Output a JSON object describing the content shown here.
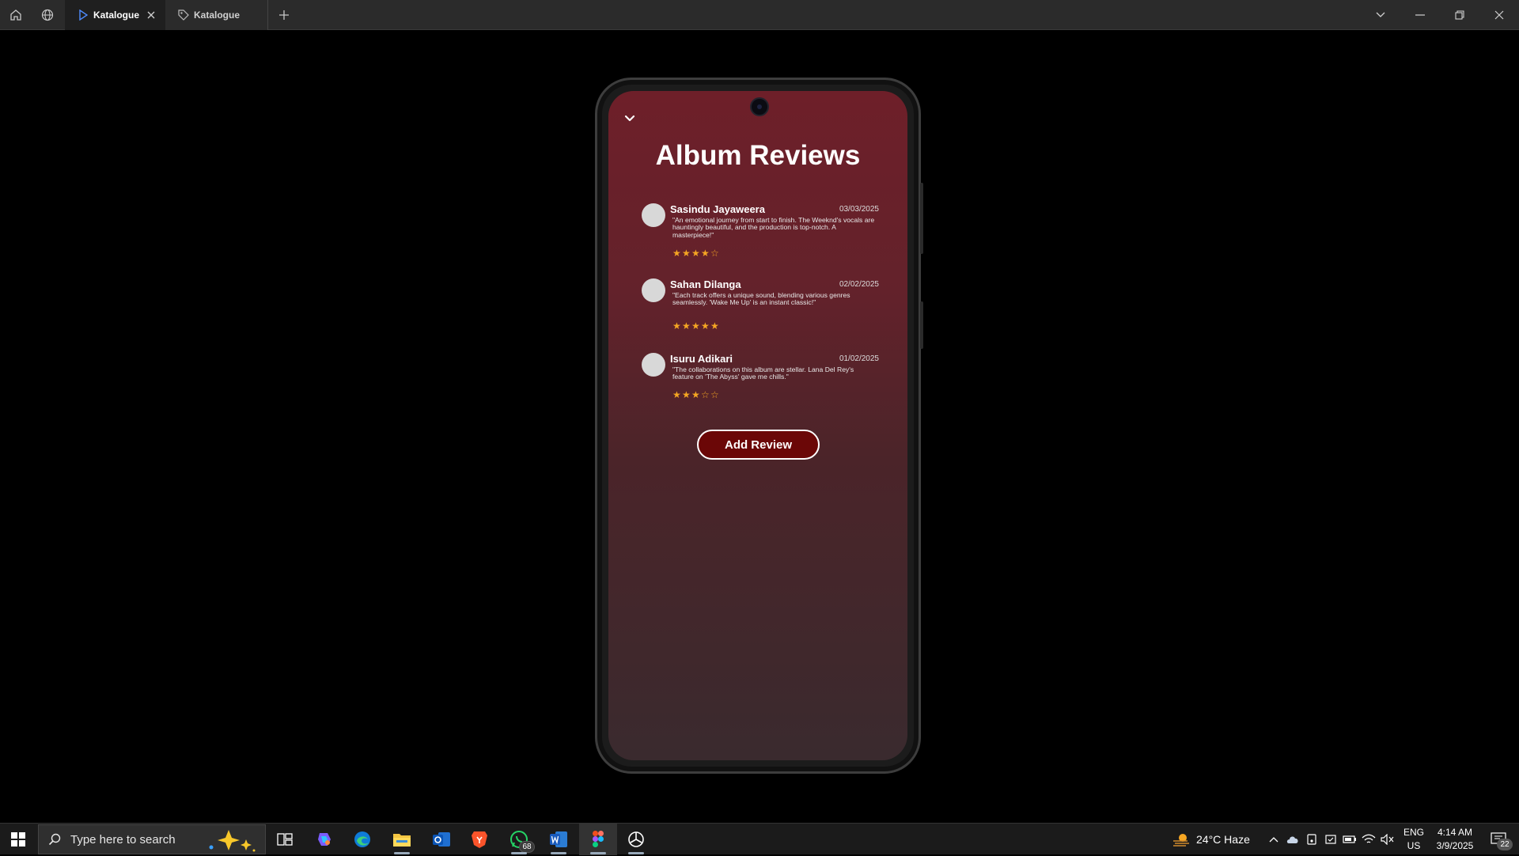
{
  "browser": {
    "tabs": [
      {
        "label": "Katalogue",
        "active": true
      },
      {
        "label": "Katalogue",
        "active": false
      }
    ]
  },
  "app": {
    "title": "Album Reviews",
    "add_review_label": "Add Review",
    "reviews": [
      {
        "name": "Sasindu Jayaweera",
        "date": "03/03/2025",
        "text": "\"An emotional journey from start to finish. The Weeknd's vocals are hauntingly beautiful, and the production is top-notch. A masterpiece!\"",
        "rating": 4,
        "rating_max": 5
      },
      {
        "name": "Sahan Dilanga",
        "date": "02/02/2025",
        "text": "\"Each track offers a unique sound, blending various genres seamlessly. 'Wake Me Up' is an instant classic!\"",
        "rating": 5,
        "rating_max": 5
      },
      {
        "name": "Isuru Adikari",
        "date": "01/02/2025",
        "text": "\"The collaborations on this album are stellar. Lana Del Rey's feature on 'The Abyss' gave me chills.\"",
        "rating": 3,
        "rating_max": 5
      }
    ],
    "colors": {
      "accent_star": "#f5a623",
      "button_bg": "#6b0707"
    }
  },
  "taskbar": {
    "search_placeholder": "Type here to search",
    "whatsapp_badge": "68",
    "weather": "24°C  Haze",
    "lang_line1": "ENG",
    "lang_line2": "US",
    "time": "4:14 AM",
    "date": "3/9/2025",
    "notification_count": "22",
    "apps": [
      "task-view-icon",
      "copilot-icon",
      "edge-icon",
      "file-explorer-icon",
      "outlook-icon",
      "brave-icon",
      "whatsapp-icon",
      "word-icon",
      "figma-icon",
      "chatgpt-icon"
    ]
  }
}
